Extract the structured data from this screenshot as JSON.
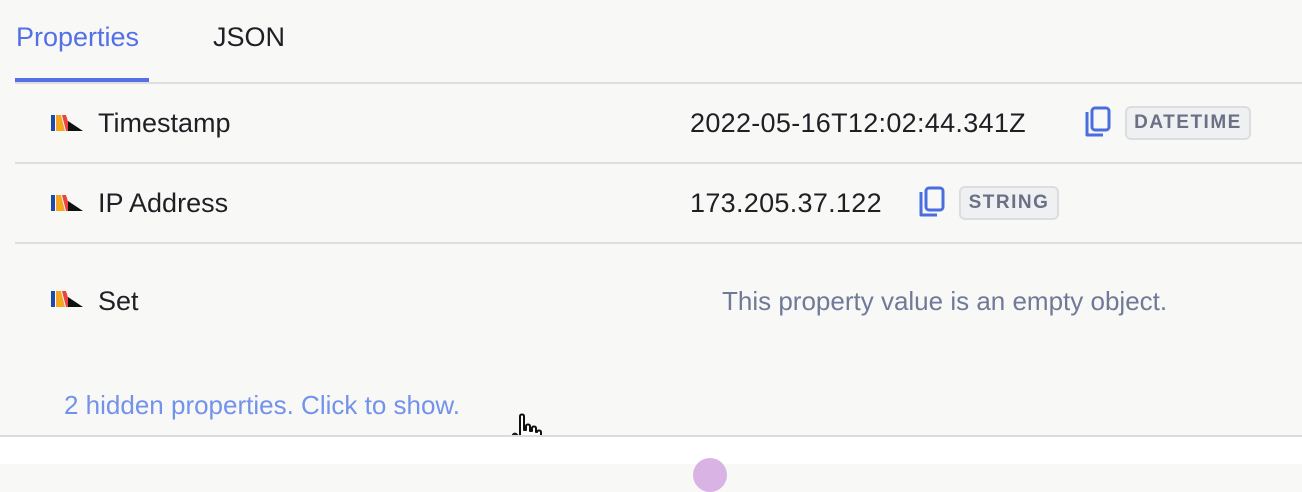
{
  "tabs": [
    {
      "label": "Properties",
      "active": true
    },
    {
      "label": "JSON",
      "active": false
    }
  ],
  "properties": [
    {
      "name": "Timestamp",
      "value": "2022-05-16T12:02:44.341Z",
      "type": "DATETIME",
      "icon": "custom-property-icon"
    },
    {
      "name": "IP Address",
      "value": "173.205.37.122",
      "type": "STRING",
      "icon": "custom-property-icon"
    },
    {
      "name": "Set",
      "empty_message": "This property value is an empty object.",
      "icon": "custom-property-icon"
    }
  ],
  "hidden_link": "2 hidden properties. Click to show.",
  "colors": {
    "accent": "#5470e6",
    "link": "#7392ea",
    "muted": "#707a97",
    "divider": "#dedede",
    "badge_bg": "#eff0f2"
  }
}
